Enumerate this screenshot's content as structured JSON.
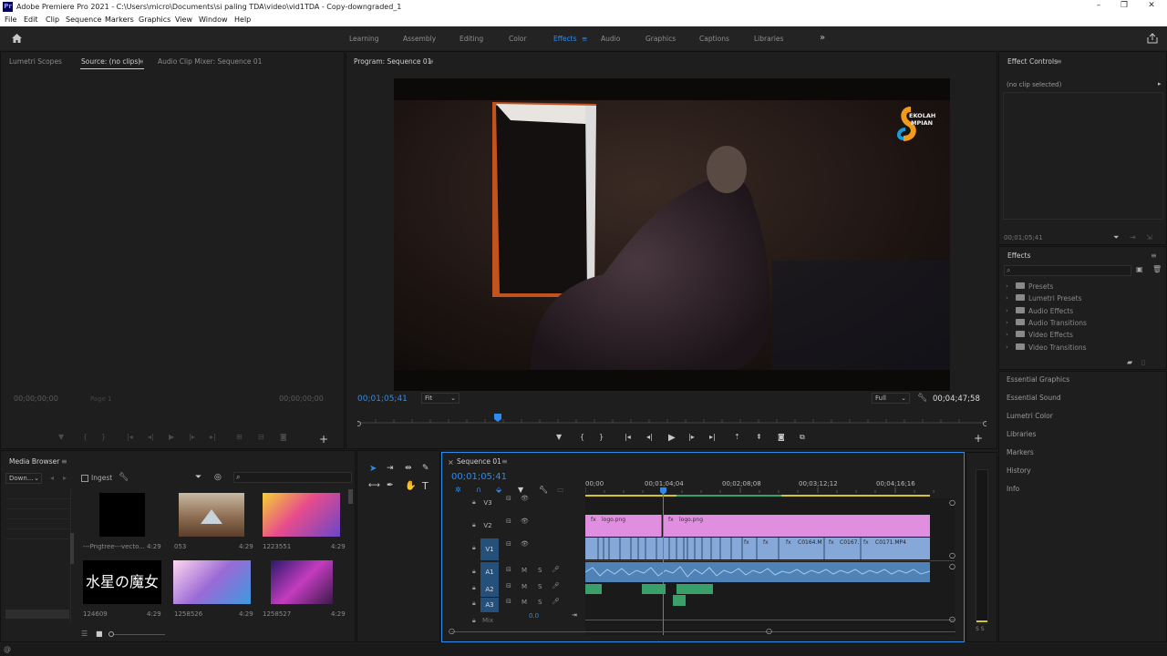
{
  "window": {
    "app_badge": "Pr",
    "title": "Adobe Premiere Pro 2021 - C:\\Users\\micro\\Documents\\si paling TDA\\video\\vid1TDA - Copy-downgraded_1",
    "minimize": "–",
    "maximize": "❐",
    "close": "✕"
  },
  "menu": [
    "File",
    "Edit",
    "Clip",
    "Sequence",
    "Markers",
    "Graphics",
    "View",
    "Window",
    "Help"
  ],
  "workspaces": {
    "items": [
      "Learning",
      "Assembly",
      "Editing",
      "Color",
      "Effects",
      "Audio",
      "Graphics",
      "Captions",
      "Libraries"
    ],
    "active": "Effects",
    "overflow": "»"
  },
  "source_panel": {
    "tabs": [
      "Lumetri Scopes",
      "Source: (no clips)",
      "Audio Clip Mixer: Sequence 01"
    ],
    "timecode_left": "00;00;00;00",
    "page": "Page 1",
    "timecode_right": "00;00;00;00"
  },
  "program_monitor": {
    "title": "Program: Sequence 01",
    "timecode": "00;01;05;41",
    "fit": "Fit",
    "quality": "Full",
    "duration": "00;04;47;58",
    "logo_text_top": "EKOLAH",
    "logo_text_bottom": "MPIAN"
  },
  "effect_controls": {
    "title": "Effect Controls",
    "no_clip": "(no clip selected)",
    "timecode": "00;01;05;41"
  },
  "effects_panel": {
    "title": "Effects",
    "search_placeholder": "",
    "folders": [
      "Presets",
      "Lumetri Presets",
      "Audio Effects",
      "Audio Transitions",
      "Video Effects",
      "Video Transitions"
    ]
  },
  "side_panels": [
    "Essential Graphics",
    "Essential Sound",
    "Lumetri Color",
    "Libraries",
    "Markers",
    "History",
    "Info"
  ],
  "media_browser": {
    "title": "Media Browser",
    "location": "Down...",
    "ingest": "Ingest",
    "search_placeholder": "",
    "items": [
      {
        "name": "---Pngtree---vecto...",
        "duration": "4:29",
        "color": "#000000"
      },
      {
        "name": "053",
        "duration": "4:29",
        "color": "#b08e70"
      },
      {
        "name": "1223551",
        "duration": "4:29",
        "color": "#d84a8c"
      },
      {
        "name": "124609",
        "duration": "4:29",
        "color": "#000000",
        "jp": "水星の魔女"
      },
      {
        "name": "1258526",
        "duration": "4:29",
        "color": "#9a6ad6"
      },
      {
        "name": "1258527",
        "duration": "4:29",
        "color": "#c43cc0"
      }
    ]
  },
  "timeline": {
    "title": "Sequence 01",
    "close": "×",
    "timecode": "00;01;05;41",
    "ruler": [
      "00;00",
      "00;01;04;04",
      "00;02;08;08",
      "00;03;12;12",
      "00;04;16;16"
    ],
    "tracks": {
      "video": [
        "V3",
        "V2",
        "V1"
      ],
      "audio": [
        "A1",
        "A2",
        "A3"
      ],
      "mix_label": "Mix",
      "mix_value": "0.0",
      "m_label": "M",
      "s_label": "S"
    },
    "clips_v2": [
      {
        "label": "logo.png"
      },
      {
        "label": "logo.png"
      }
    ],
    "clips_v1": [
      {
        "label": "C0164.M"
      },
      {
        "label": "C0167."
      },
      {
        "label": "C0171.MP4"
      }
    ],
    "fx_badge": "fx"
  },
  "audio_meter": {
    "solo_labels": "S S"
  },
  "status_bar": {
    "icon": "@"
  },
  "colors": {
    "accent_blue": "#2d8ceb",
    "v2_clip": "#e08fe0",
    "v1_clip": "#85a8d8",
    "audio_clip": "#4f83b8",
    "green_clip": "#3aa06a"
  }
}
